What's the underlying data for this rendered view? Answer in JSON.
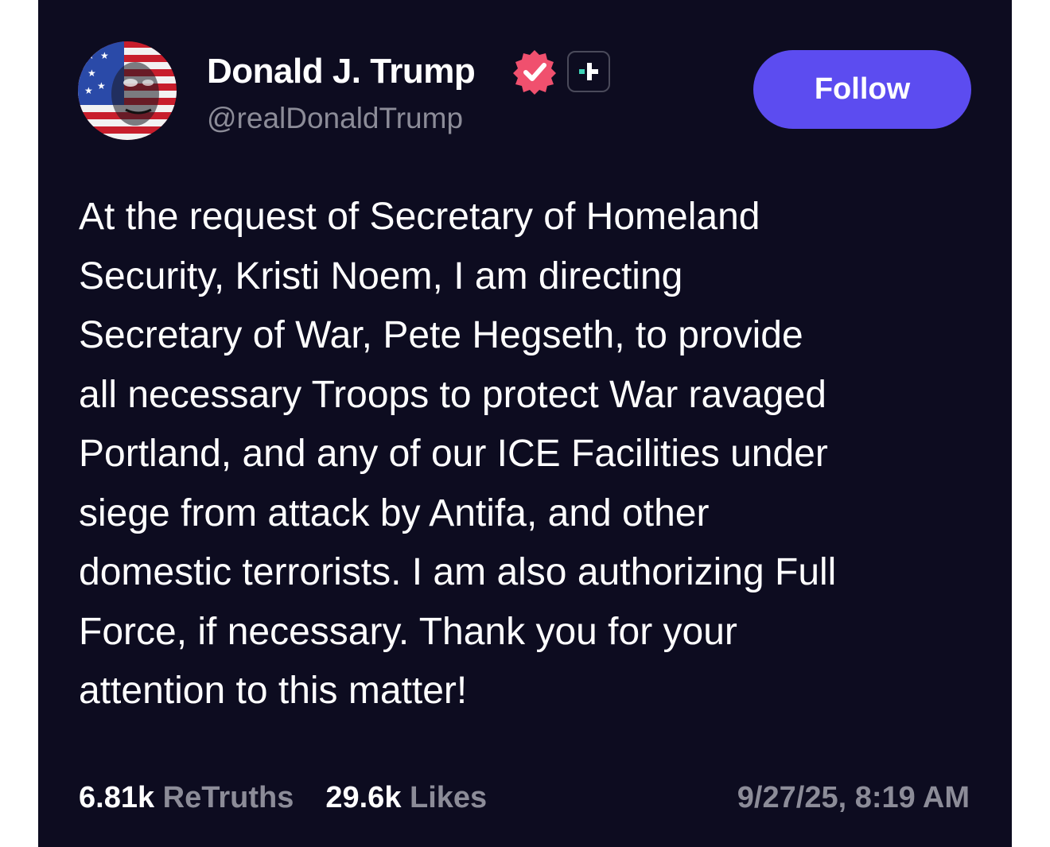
{
  "author": {
    "display_name": "Donald J. Trump",
    "handle": "@realDonaldTrump",
    "verified_badge_icon": "verified-check-icon",
    "plus_badge_icon": "truth-plus-icon",
    "avatar_icon": "american-flag-portrait-avatar"
  },
  "follow": {
    "label": "Follow"
  },
  "post": {
    "lines": [
      "At the request of Secretary of Homeland",
      "Security, Kristi Noem, I am directing",
      "Secretary of War, Pete Hegseth, to provide",
      "all necessary Troops to protect War ravaged",
      "Portland, and any of our ICE Facilities under",
      "siege from attack by Antifa, and other",
      "domestic terrorists. I am also authorizing Full",
      "Force, if necessary. Thank you for your",
      "attention to this matter!"
    ]
  },
  "stats": {
    "retruths_count": "6.81k",
    "retruths_label": "ReTruths",
    "likes_count": "29.6k",
    "likes_label": "Likes",
    "timestamp": "9/27/25, 8:19 AM"
  },
  "colors": {
    "background": "#0d0c20",
    "follow_button": "#5c4cf0",
    "verified_badge": "#f0506e",
    "plus_accent": "#3fd1b5",
    "muted_text": "#8c8c98"
  }
}
